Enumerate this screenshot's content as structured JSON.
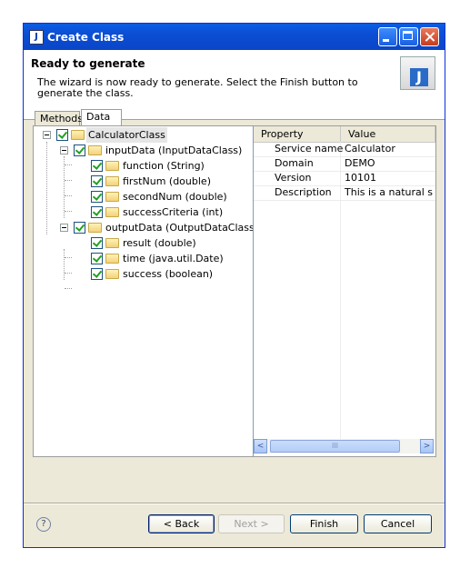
{
  "window": {
    "title": "Create Class"
  },
  "banner": {
    "heading": "Ready to generate",
    "description": "The wizard is now ready to generate. Select the Finish button to generate the class."
  },
  "tabs": [
    {
      "label": "Methods",
      "active": false
    },
    {
      "label": "Data",
      "active": true
    }
  ],
  "tree": {
    "root": "CalculatorClass",
    "input": {
      "label": "inputData (InputDataClass)",
      "children": [
        "function (String)",
        "firstNum (double)",
        "secondNum (double)",
        "successCriteria (int)"
      ]
    },
    "output": {
      "label": "outputData (OutputDataClass)",
      "children": [
        "result (double)",
        "time (java.util.Date)",
        "success (boolean)"
      ]
    }
  },
  "properties": {
    "headers": {
      "property": "Property",
      "value": "Value"
    },
    "rows": [
      {
        "key": "Service name",
        "value": "Calculator"
      },
      {
        "key": "Domain",
        "value": "DEMO"
      },
      {
        "key": "Version",
        "value": "10101"
      },
      {
        "key": "Description",
        "value": "This is a natural sub"
      }
    ],
    "scroll": {
      "left": "<",
      "right": ">",
      "grip": "III"
    }
  },
  "buttons": {
    "help": "?",
    "back": "< Back",
    "next": "Next >",
    "finish": "Finish",
    "cancel": "Cancel"
  },
  "colors": {
    "titlebar": "#0a5de5",
    "dialog": "#ece9d8",
    "check": "#21a121"
  }
}
